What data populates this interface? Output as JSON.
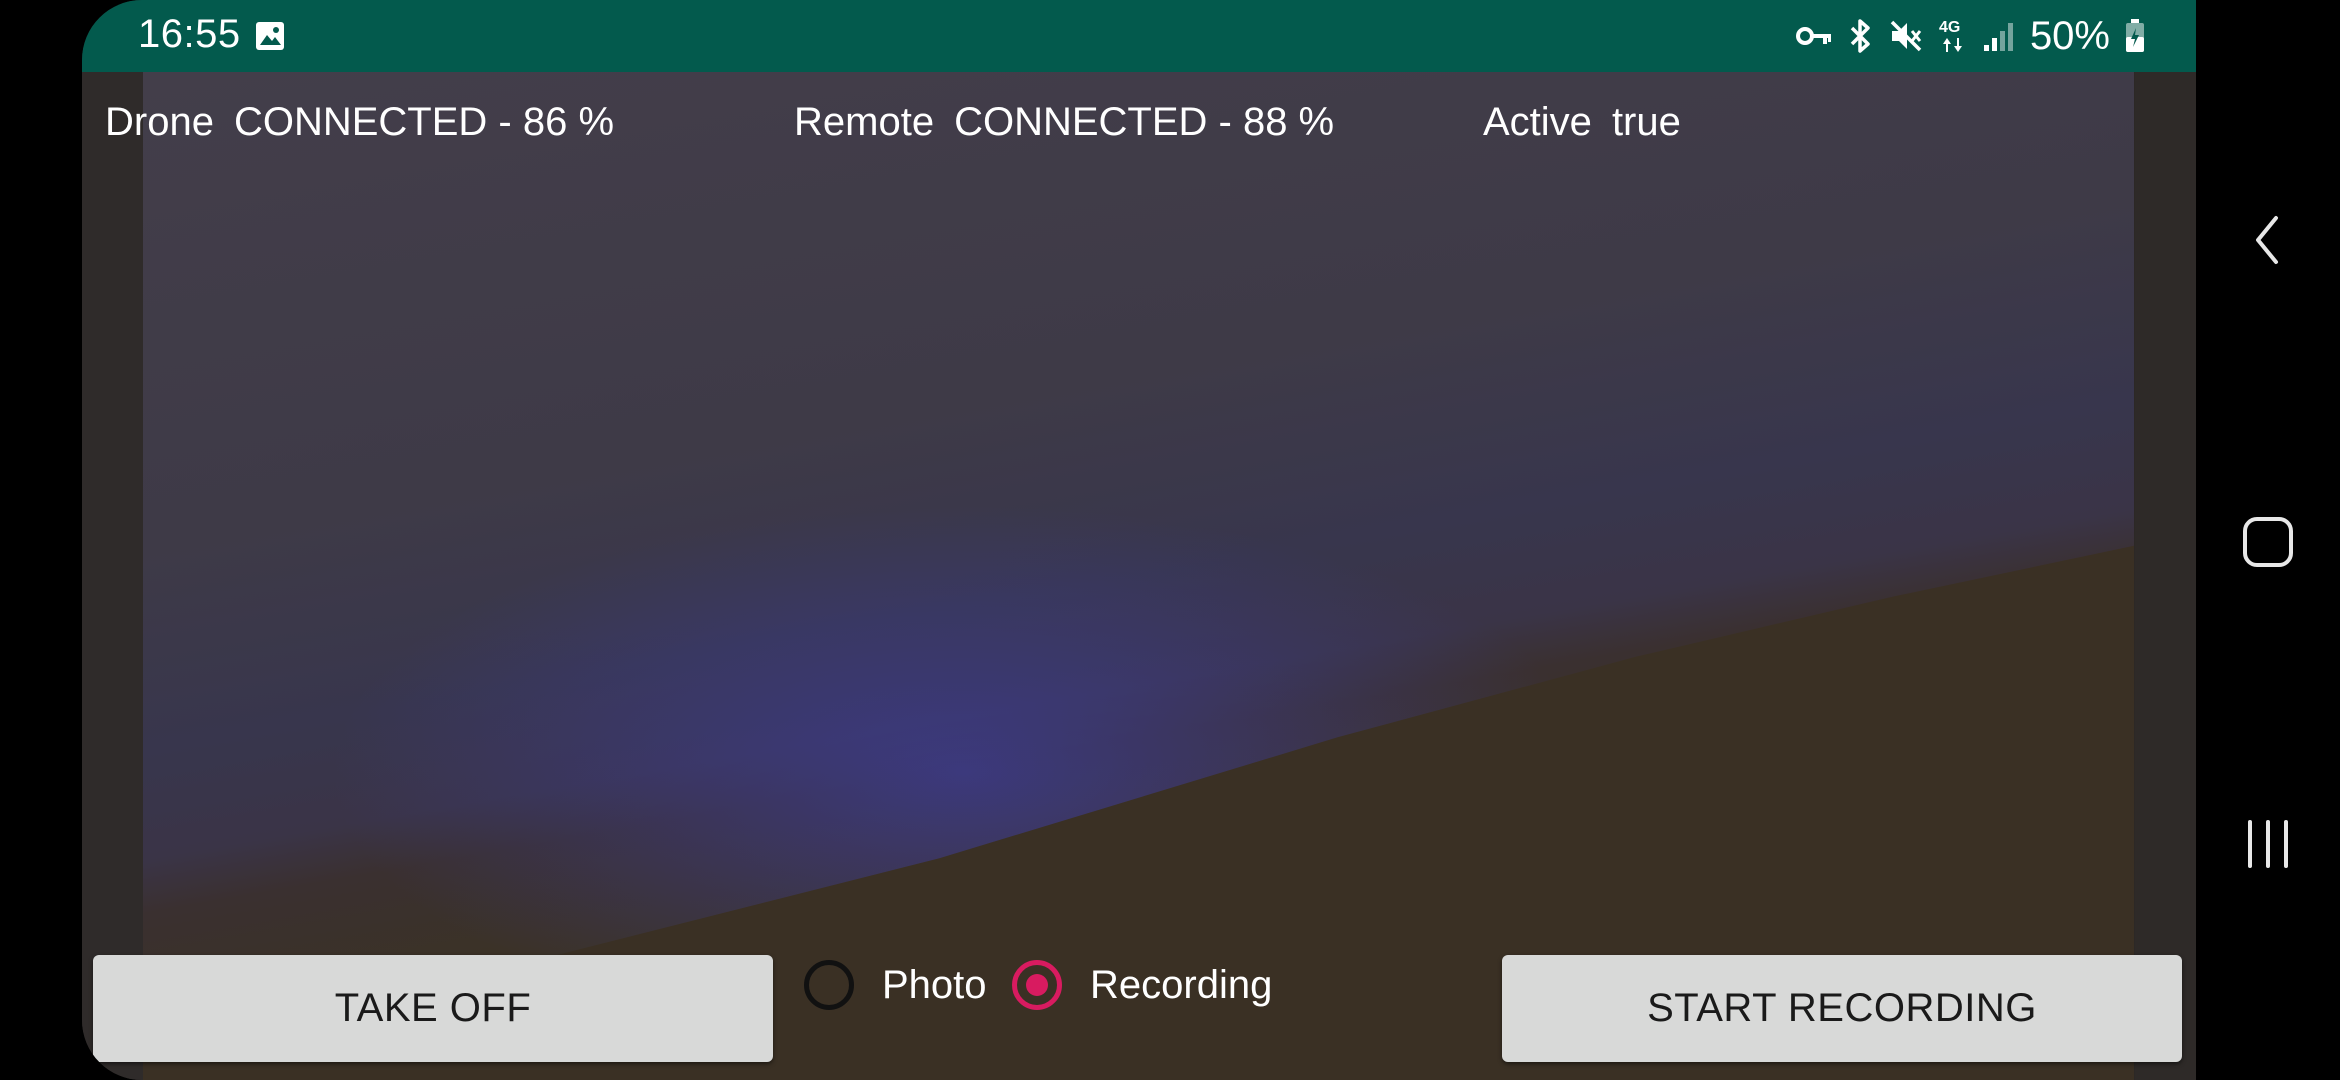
{
  "status_bar": {
    "time": "16:55",
    "battery_percent": "50%",
    "icons": [
      "gallery-icon",
      "key-icon",
      "bluetooth-icon",
      "mute-icon",
      "4g-icon",
      "signal-icon",
      "battery-icon"
    ],
    "background_color": "#035a4d"
  },
  "info": {
    "drone_label": "Drone",
    "drone_value": "CONNECTED - 86 %",
    "remote_label": "Remote",
    "remote_value": "CONNECTED - 88 %",
    "active_label": "Active",
    "active_value": "true"
  },
  "controls": {
    "take_off_label": "TAKE OFF",
    "start_recording_label": "START RECORDING",
    "mode_options": [
      {
        "label": "Photo",
        "selected": false
      },
      {
        "label": "Recording",
        "selected": true
      }
    ],
    "accent_color": "#d81b60"
  },
  "nav": {
    "icons": [
      "back-icon",
      "home-icon",
      "recents-icon"
    ]
  }
}
